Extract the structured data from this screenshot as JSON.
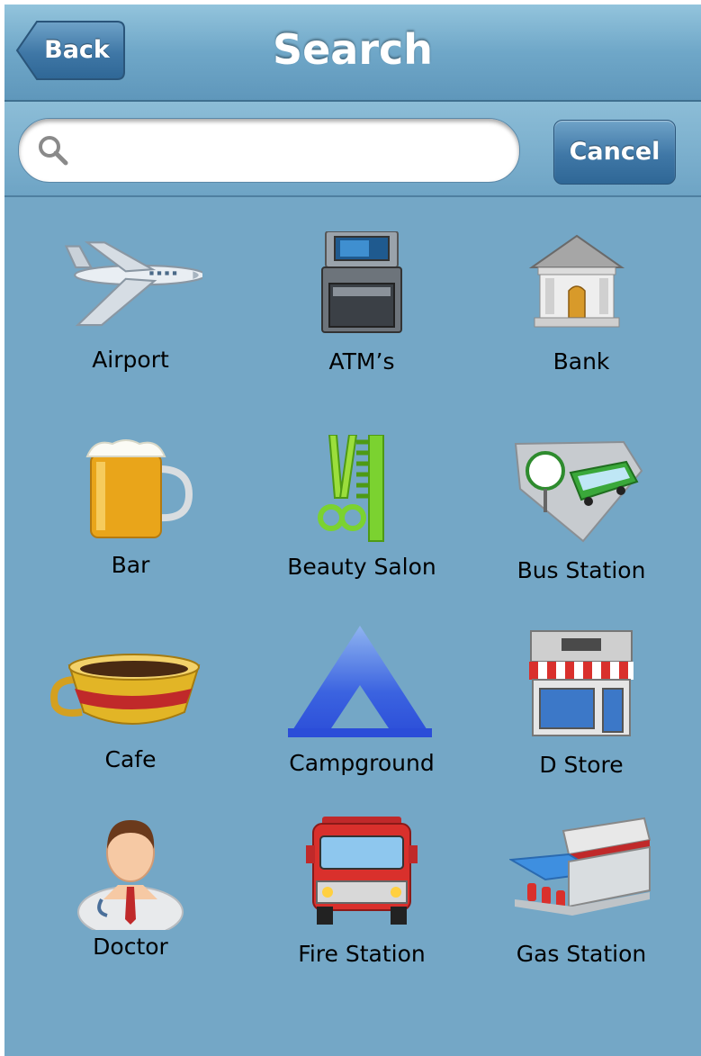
{
  "navbar": {
    "back_label": "Back",
    "title": "Search"
  },
  "search": {
    "value": "",
    "placeholder": "",
    "cancel_label": "Cancel"
  },
  "categories": [
    {
      "label": "Airport",
      "icon": "airplane-icon"
    },
    {
      "label": "ATM’s",
      "icon": "atm-icon"
    },
    {
      "label": "Bank",
      "icon": "bank-icon"
    },
    {
      "label": "Bar",
      "icon": "beer-mug-icon"
    },
    {
      "label": "Beauty Salon",
      "icon": "comb-scissors-icon"
    },
    {
      "label": "Bus Station",
      "icon": "bus-stop-icon"
    },
    {
      "label": "Cafe",
      "icon": "coffee-cup-icon"
    },
    {
      "label": "Campground",
      "icon": "tent-icon"
    },
    {
      "label": "D Store",
      "icon": "store-icon"
    },
    {
      "label": "Doctor",
      "icon": "doctor-icon"
    },
    {
      "label": "Fire Station",
      "icon": "fire-truck-icon"
    },
    {
      "label": "Gas Station",
      "icon": "gas-station-icon"
    }
  ],
  "colors": {
    "background": "#74a7c6",
    "navbar": "#6fa7c8",
    "button": "#3f77a6",
    "text": "#000000",
    "button_text": "#ffffff"
  }
}
